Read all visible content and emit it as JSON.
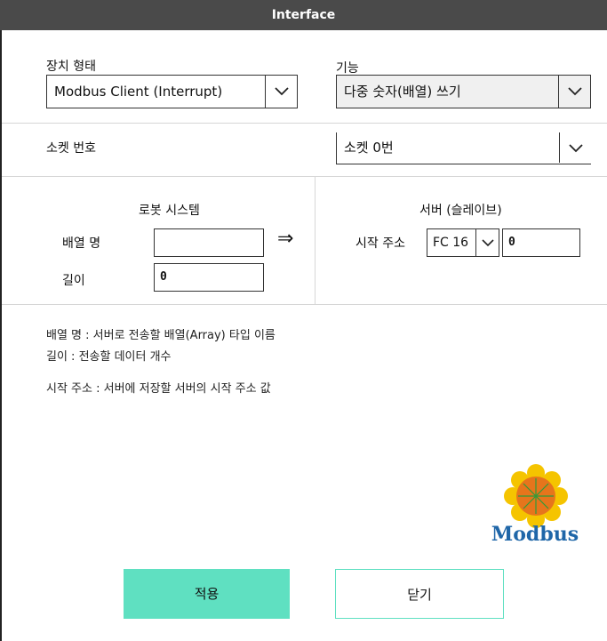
{
  "window": {
    "title": "Interface"
  },
  "device_type": {
    "label": "장치 형태",
    "value": "Modbus Client (Interrupt)"
  },
  "function": {
    "label": "기능",
    "value": "다중 숫자(배열) 쓰기"
  },
  "socket": {
    "label": "소켓 번호",
    "value": "소켓 0번"
  },
  "robot": {
    "header": "로봇 시스템",
    "array_name_label": "배열 명",
    "array_name_value": "",
    "length_label": "길이",
    "length_value": "0"
  },
  "arrow": "⇒",
  "server": {
    "header": "서버 (슬레이브)",
    "start_address_label": "시작 주소",
    "fc_value": "FC 16",
    "address_value": "0"
  },
  "descriptions": [
    "배열 명 : 서버로 전송할 배열(Array) 타입 이름",
    "길이 : 전송할 데이터 개수",
    "시작 주소 : 서버에 저장할 서버의 시작 주소 값"
  ],
  "logo": {
    "text": "Modbus",
    "text_color": "#1f66a8",
    "flower_color": "#f5c400",
    "center_color": "#e6751c"
  },
  "buttons": {
    "apply": "적용",
    "close": "닫기"
  },
  "colors": {
    "accent": "#5fe0c1",
    "titlebar": "#4a4a4a"
  }
}
